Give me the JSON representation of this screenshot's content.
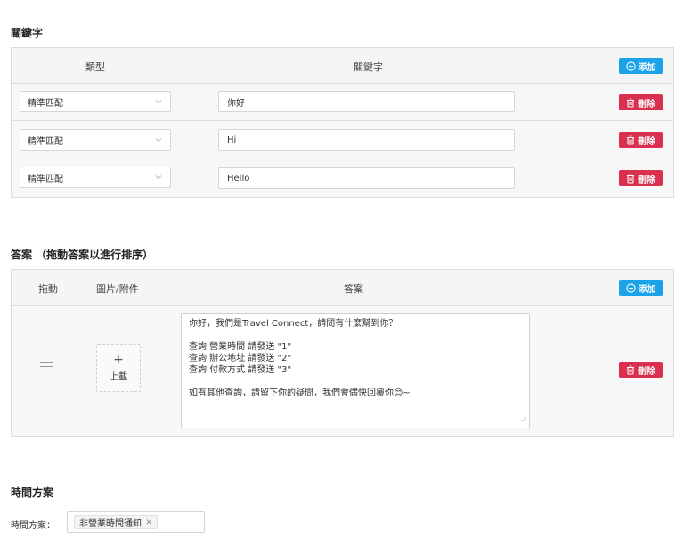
{
  "keywords_section": {
    "title": "關鍵字",
    "header": {
      "type_label": "類型",
      "keyword_label": "關鍵字",
      "add_label": "添加"
    },
    "rows": [
      {
        "match_type": "精準匹配",
        "keyword": "你好",
        "delete_label": "刪除"
      },
      {
        "match_type": "精準匹配",
        "keyword": "Hi",
        "delete_label": "刪除"
      },
      {
        "match_type": "精準匹配",
        "keyword": "Hello",
        "delete_label": "刪除"
      }
    ]
  },
  "answers_section": {
    "title": "答案 （拖動答案以進行排序）",
    "header": {
      "drag_label": "拖動",
      "media_label": "圖片/附件",
      "answer_label": "答案",
      "add_label": "添加"
    },
    "rows": [
      {
        "upload_plus": "+",
        "upload_label": "上載",
        "delete_label": "刪除",
        "answer_lines": [
          "你好，我們是Travel Connect，請問有什麼幫到你？",
          "",
          "查詢 營業時間 請發送 \"1\"",
          "查詢 辦公地址 請發送 \"2\"",
          "查詢 付款方式 請發送 \"3\"",
          "",
          "如有其他查詢，請留下你的疑問，我們會儘快回覆你😊~"
        ]
      }
    ]
  },
  "time_plan_section": {
    "title": "時間方案",
    "field_label": "時間方案：",
    "tag_label": "非營業時間通知",
    "tag_remove": "×"
  },
  "colors": {
    "add_button": "#1aa3e8",
    "delete_button": "#d9304f",
    "border": "#dcdcdc"
  },
  "icons": {
    "add": "plus-circle-icon",
    "delete": "trash-icon",
    "select": "chevron-down-icon",
    "drag": "drag-handle-icon"
  }
}
